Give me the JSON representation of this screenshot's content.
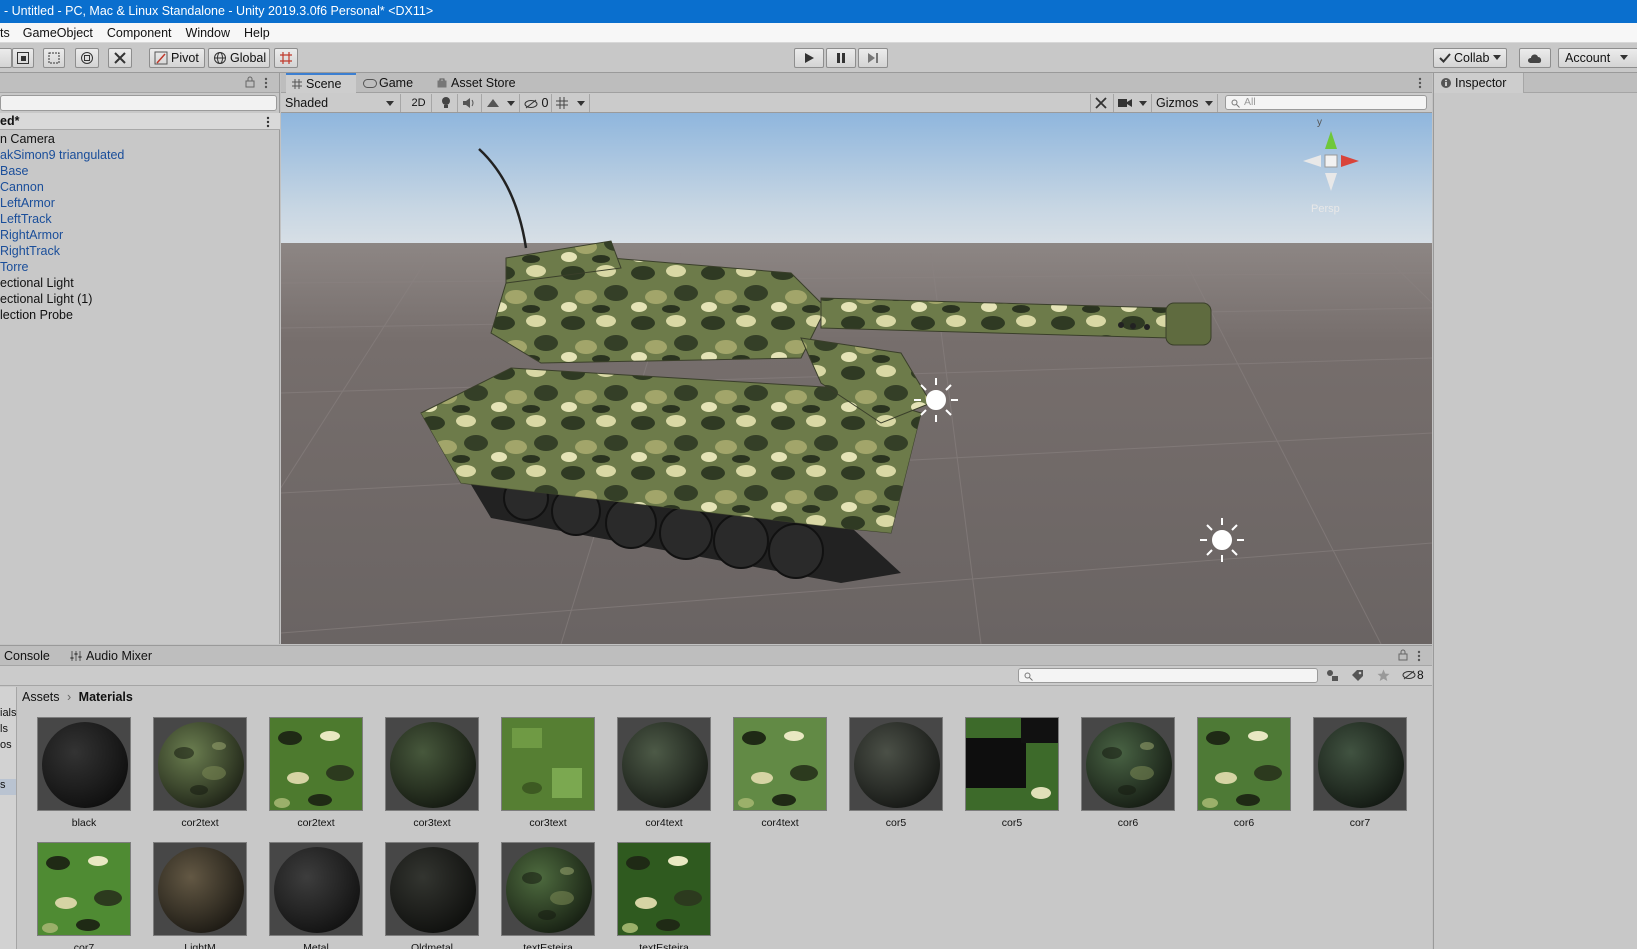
{
  "window": {
    "title": "- Untitled - PC, Mac & Linux Standalone - Unity 2019.3.0f6 Personal* <DX11>"
  },
  "menu": [
    "ts",
    "GameObject",
    "Component",
    "Window",
    "Help"
  ],
  "toolbar": {
    "pivot_label": "Pivot",
    "global_label": "Global",
    "collab_label": "Collab",
    "account_label": "Account"
  },
  "hierarchy": {
    "scene_name": "ed*",
    "items": [
      {
        "label": "n Camera",
        "prefab": false
      },
      {
        "label": "akSimon9 triangulated",
        "prefab": true
      },
      {
        "label": "Base",
        "prefab": true
      },
      {
        "label": "Cannon",
        "prefab": true
      },
      {
        "label": "LeftArmor",
        "prefab": true
      },
      {
        "label": "LeftTrack",
        "prefab": true
      },
      {
        "label": "RightArmor",
        "prefab": true
      },
      {
        "label": "RightTrack",
        "prefab": true
      },
      {
        "label": "Torre",
        "prefab": true
      },
      {
        "label": "ectional Light",
        "prefab": false
      },
      {
        "label": "ectional Light (1)",
        "prefab": false
      },
      {
        "label": "lection Probe",
        "prefab": false
      }
    ]
  },
  "scene": {
    "tabs": [
      "Scene",
      "Game",
      "Asset Store"
    ],
    "draw_mode": "Shaded",
    "mode_2d": "2D",
    "hidden_count": "0",
    "gizmos_label": "Gizmos",
    "search_placeholder": "All",
    "persp_label": "Persp",
    "axis_y": "y"
  },
  "inspector": {
    "tab_label": "Inspector"
  },
  "project": {
    "tabs": [
      "Console",
      "Audio Mixer"
    ],
    "hidden_count": "8",
    "breadcrumb": [
      "Assets",
      "Materials"
    ],
    "left_stub": [
      "ials",
      "ls",
      "os",
      "s"
    ],
    "materials": [
      {
        "name": "black",
        "kind": "sphere",
        "color": "#1e1e1e"
      },
      {
        "name": "cor2text",
        "kind": "camo-sphere",
        "color": "#3f4a2f"
      },
      {
        "name": "cor2text",
        "kind": "camo-flat",
        "color": "#4d7a2e"
      },
      {
        "name": "cor3text",
        "kind": "sphere",
        "color": "#2a3423"
      },
      {
        "name": "cor3text",
        "kind": "flat",
        "color": "#567f33"
      },
      {
        "name": "cor4text",
        "kind": "sphere",
        "color": "#2d352a"
      },
      {
        "name": "cor4text",
        "kind": "camo-flat",
        "color": "#628a45"
      },
      {
        "name": "cor5",
        "kind": "sphere",
        "color": "#2c2f2a"
      },
      {
        "name": "cor5",
        "kind": "dark-flat",
        "color": "#3d6a2a"
      },
      {
        "name": "cor6",
        "kind": "camo-sphere",
        "color": "#2b3a28"
      },
      {
        "name": "cor6",
        "kind": "camo-flat",
        "color": "#4e7a36"
      },
      {
        "name": "cor7",
        "kind": "sphere",
        "color": "#263126"
      },
      {
        "name": "cor7",
        "kind": "camo-flat",
        "color": "#4f8b33"
      },
      {
        "name": "LightM",
        "kind": "sphere",
        "color": "#3a3428"
      },
      {
        "name": "Metal",
        "kind": "sphere",
        "color": "#242424"
      },
      {
        "name": "Oldmetal",
        "kind": "sphere",
        "color": "#1e1f1c"
      },
      {
        "name": "textEsteira",
        "kind": "camo-sphere",
        "color": "#2e3f25"
      },
      {
        "name": "textEsteira",
        "kind": "camo-flat",
        "color": "#2f5a1f"
      }
    ]
  },
  "colors": {
    "titlebar": "#0a6fce",
    "prefab_text": "#1a4e9a",
    "accent_tab": "#3c7fd1",
    "sky_top": "#8fb6dd",
    "ground": "#6a6463"
  }
}
